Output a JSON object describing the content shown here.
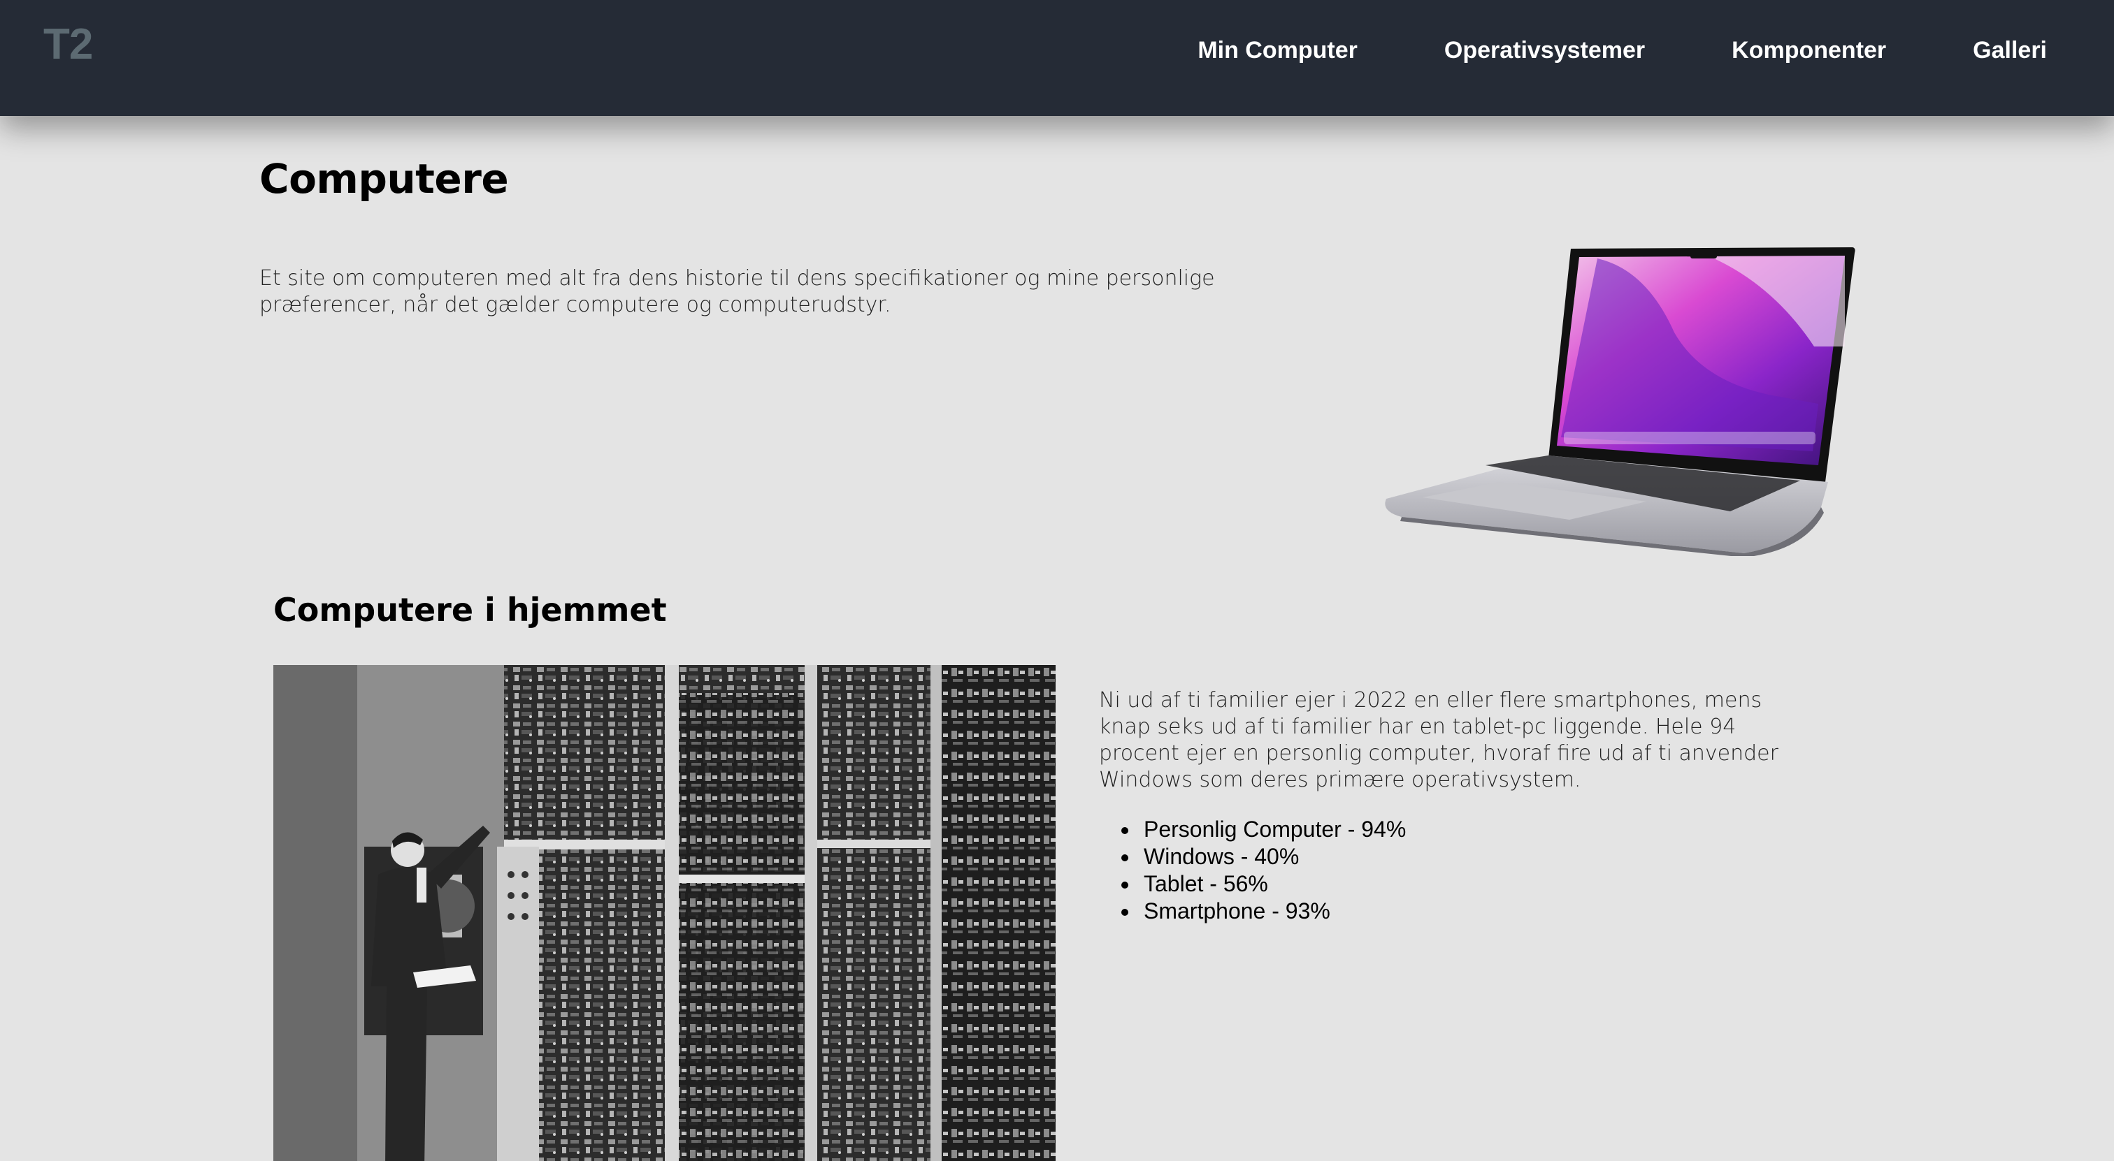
{
  "header": {
    "logo": "T2",
    "nav": [
      "Min Computer",
      "Operativsystemer",
      "Komponenter",
      "Galleri"
    ]
  },
  "hero": {
    "title": "Computere",
    "text": "Et site om computeren med alt fra dens historie til dens specifikationer og mine personlige præferencer, når det gælder computere og computerudstyr."
  },
  "home_section": {
    "title": "Computere i hjemmet",
    "text": "Ni ud af ti familier ejer i 2022 en eller flere smartphones, mens knap seks ud af ti familier har en tablet-pc liggende. Hele 94 procent ejer en personlig computer, hvoraf fire ud af ti anvender Windows som deres primære operativsystem.",
    "stats": [
      "Personlig Computer - 94%",
      "Windows - 40%",
      "Tablet - 56%",
      "Smartphone - 93%"
    ]
  },
  "colors": {
    "header_bg": "#252b36",
    "page_bg": "#e4e4e4",
    "logo": "#5c6a72"
  }
}
